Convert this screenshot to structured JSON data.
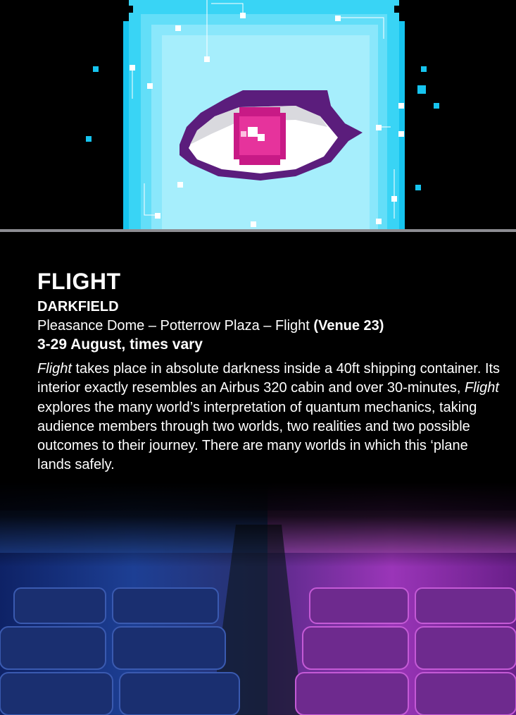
{
  "hero": {
    "image": "pixel-art-eye-icon",
    "colors": {
      "background": "#000000",
      "cyan": "#1ec8f0",
      "light_cyan": "#a8eefc",
      "purple": "#5a1d7a",
      "magenta": "#d6208c"
    }
  },
  "event": {
    "title": "FLIGHT",
    "company": "DARKFIELD",
    "venue_text": "Pleasance Dome – Potterrow Plaza – Flight ",
    "venue_number": "(Venue 23)",
    "dates": "3-29 August, times vary",
    "description": {
      "title_italic_1": "Flight",
      "part_1": " takes place in absolute darkness inside a 40ft shipping container. Its interior exactly resembles an Airbus 320 cabin and over 30-minutes, ",
      "title_italic_2": "Flight",
      "part_2": " explores the many world’s interpretation of quantum mechanics, taking audience members through two worlds, two realities and two possible outcomes to their journey. There are many worlds in which this ‘plane lands safely."
    }
  },
  "footer_image": {
    "image": "airplane-cabin-seats-image",
    "colors": {
      "left_tone": "#1a3a8a",
      "right_tone": "#b030c0"
    }
  }
}
